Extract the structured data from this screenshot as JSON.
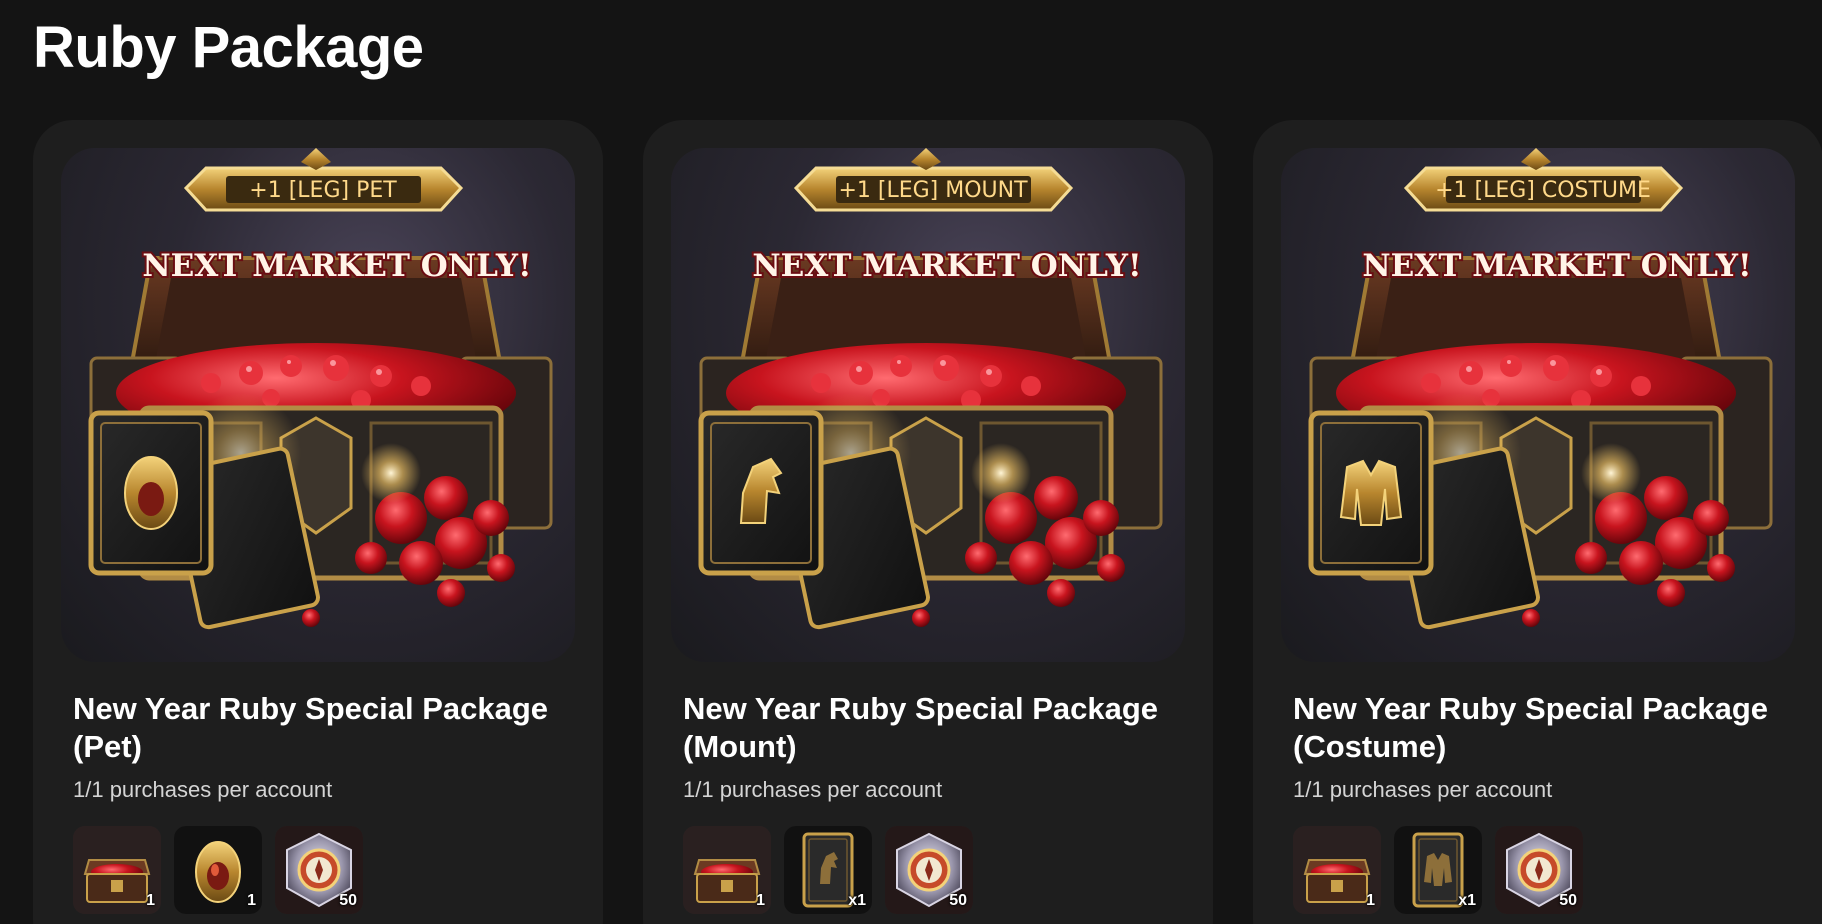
{
  "section": {
    "title": "Ruby Package"
  },
  "colors": {
    "background": "#141414",
    "card": "#1e1e1e",
    "ruby": "#c8141e",
    "gold": "#c9a14a"
  },
  "cards": [
    {
      "banner": "+1 [LEG] PET",
      "market": "NEXT MARKET ONLY!",
      "card_icon": "egg-icon",
      "title": "New Year Ruby Special Package (Pet)",
      "limit": "1/1 purchases per account",
      "items": [
        {
          "icon": "ruby-chest-icon",
          "qty": "1"
        },
        {
          "icon": "egg-icon",
          "qty": "1"
        },
        {
          "icon": "compass-token-icon",
          "qty": "50"
        }
      ]
    },
    {
      "banner": "+1 [LEG] MOUNT",
      "market": "NEXT MARKET ONLY!",
      "card_icon": "horse-icon",
      "title": "New Year Ruby Special Package (Mount)",
      "limit": "1/1 purchases per account",
      "items": [
        {
          "icon": "ruby-chest-icon",
          "qty": "1"
        },
        {
          "icon": "horse-card-icon",
          "qty": "x1"
        },
        {
          "icon": "compass-token-icon",
          "qty": "50"
        }
      ]
    },
    {
      "banner": "+1 [LEG] COSTUME",
      "market": "NEXT MARKET ONLY!",
      "card_icon": "jacket-icon",
      "title": "New Year Ruby Special Package (Costume)",
      "limit": "1/1 purchases per account",
      "items": [
        {
          "icon": "ruby-chest-icon",
          "qty": "1"
        },
        {
          "icon": "jacket-card-icon",
          "qty": "x1"
        },
        {
          "icon": "compass-token-icon",
          "qty": "50"
        }
      ]
    }
  ]
}
